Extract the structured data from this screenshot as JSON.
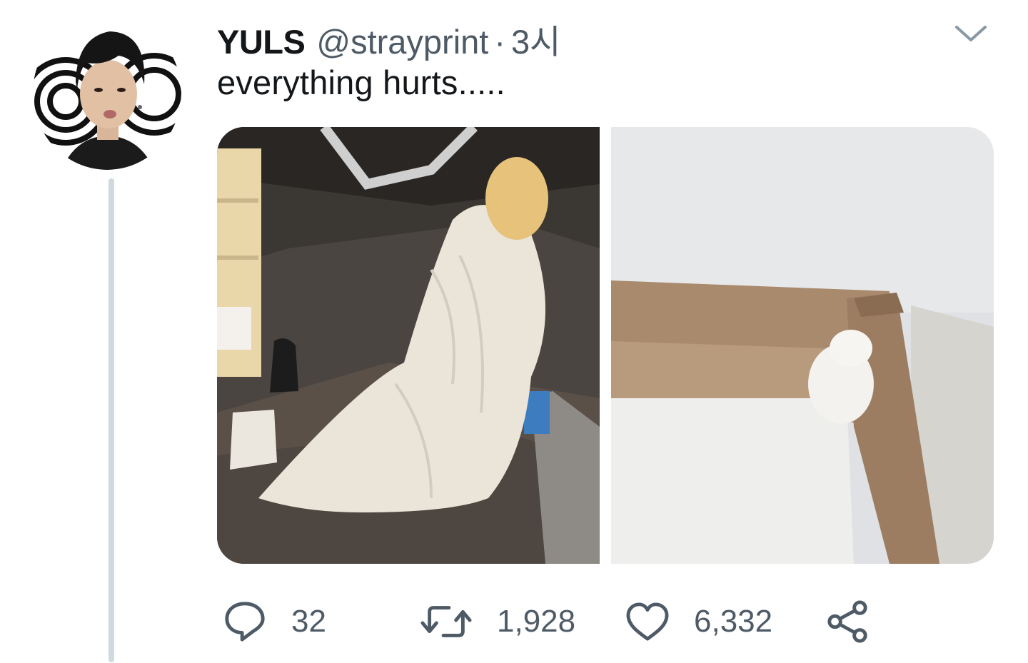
{
  "tweet": {
    "display_name": "YULS",
    "handle": "@strayprint",
    "separator": "·",
    "timestamp": "3시",
    "text": "everything hurts.....",
    "menu_icon": "chevron-down-icon"
  },
  "media": [
    {
      "description_icon": "photo-person-in-blanket"
    },
    {
      "description_icon": "photo-kitten-in-box"
    }
  ],
  "actions": {
    "reply": {
      "icon": "reply-icon",
      "count": "32"
    },
    "retweet": {
      "icon": "retweet-icon",
      "count": "1,928"
    },
    "like": {
      "icon": "heart-icon",
      "count": "6,332"
    },
    "share": {
      "icon": "share-icon"
    }
  },
  "colors": {
    "text": "#14171a",
    "secondary": "#4e5a66",
    "thread_line": "#cfd9de",
    "background": "#ffffff"
  }
}
